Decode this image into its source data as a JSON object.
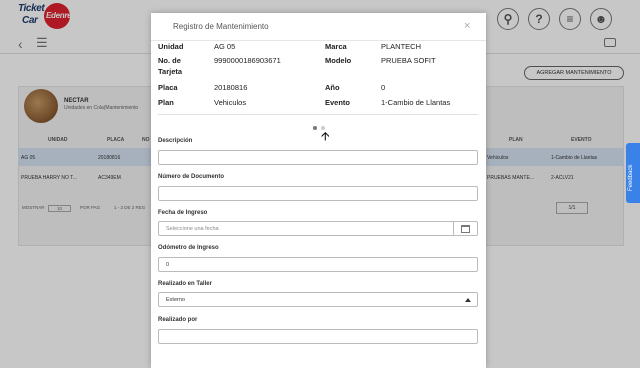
{
  "header": {
    "logo_line1": "Ticket",
    "logo_line2": "Car",
    "logo_badge": "Edenred"
  },
  "background": {
    "add_button": "AGREGAR MANTENIMIENTO",
    "card_title": "NECTAR",
    "card_subtitle": "Unidades en Cola(Mantenimiento",
    "columns": [
      "UNIDAD",
      "PLACA",
      "NO",
      "PLAN",
      "EVENTO"
    ],
    "rows": [
      {
        "unidad": "AG 05",
        "placa": "20180816",
        "plan": "Vehiculos",
        "evento": "1-Cambio de Llantas"
      },
      {
        "unidad": "PRUEBA HARRY NO T...",
        "placa": "AC349EM",
        "plan": "PRUEBAS MANTE...",
        "evento": "2-ACLV21"
      }
    ],
    "pager_left": "MOSTRAR",
    "page_size": "10",
    "pager_mid": "POR PAG",
    "pager_range": "1 - 2 DE 2 REG",
    "page_indicator": "1/1"
  },
  "feedback_label": "Feedback",
  "modal": {
    "title": "Registro de Mantenimiento",
    "close_icon": "×",
    "info": {
      "unidad_label": "Unidad",
      "unidad_value": "AG 05",
      "marca_label": "Marca",
      "marca_value": "PLANTECH",
      "tarjeta_label_1": "No. de",
      "tarjeta_label_2": "Tarjeta",
      "tarjeta_value": "9990000186903671",
      "modelo_label": "Modelo",
      "modelo_value": "PRUEBA SOFIT",
      "placa_label": "Placa",
      "placa_value": "20180816",
      "anio_label": "Año",
      "anio_value": "0",
      "plan_label": "Plan",
      "plan_value": "Vehiculos",
      "evento_label": "Evento",
      "evento_value": "1-Cambio de Llantas"
    },
    "fields": {
      "descripcion_label": "Descripción",
      "descripcion_value": "",
      "documento_label": "Número de Documento",
      "documento_value": "",
      "fecha_label": "Fecha de Ingreso",
      "fecha_placeholder": "Seleccione una fecha",
      "odometro_label": "Odómetro de Ingreso",
      "odometro_value": "0",
      "taller_label": "Realizado en Taller",
      "taller_selected": "Externo",
      "realizado_label": "Realizado por",
      "realizado_value": ""
    }
  }
}
